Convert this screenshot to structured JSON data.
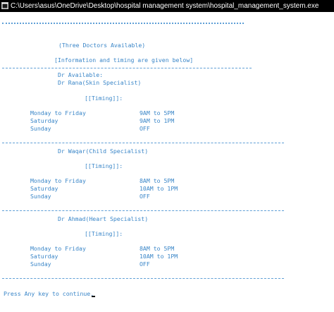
{
  "window": {
    "title": "C:\\Users\\asus\\OneDrive\\Desktop\\hospital management system\\hospital_management_system.exe"
  },
  "console": {
    "header": "(Three Doctors Available)",
    "info": "[Information and timing are given below]",
    "available": "Dr Available:",
    "timing_label": "[[Timing]]:",
    "doctors": [
      {
        "name": "Dr Rana(Skin Specialist)",
        "schedule": [
          {
            "day": "Monday to Friday",
            "time": "9AM to 5PM"
          },
          {
            "day": "Saturday",
            "time": "9AM to 1PM"
          },
          {
            "day": "Sunday",
            "time": "OFF"
          }
        ]
      },
      {
        "name": "Dr Waqar(Child Specialist)",
        "schedule": [
          {
            "day": "Monday to Friday",
            "time": "8AM to 5PM"
          },
          {
            "day": "Saturday",
            "time": "10AM to 1PM"
          },
          {
            "day": "Sunday",
            "time": "OFF"
          }
        ]
      },
      {
        "name": "Dr Ahmad(Heart Specialist)",
        "schedule": [
          {
            "day": "Monday to Friday",
            "time": "8AM to 5PM"
          },
          {
            "day": "Saturday",
            "time": "10AM to 1PM"
          },
          {
            "day": "Sunday",
            "time": "OFF"
          }
        ]
      }
    ],
    "prompt": "Press Any key to continue."
  },
  "colors": {
    "console_text": "#3a86c8",
    "console_bg": "#ffffff",
    "titlebar_bg": "#000000"
  },
  "icons": {
    "app": "console-app-icon"
  }
}
